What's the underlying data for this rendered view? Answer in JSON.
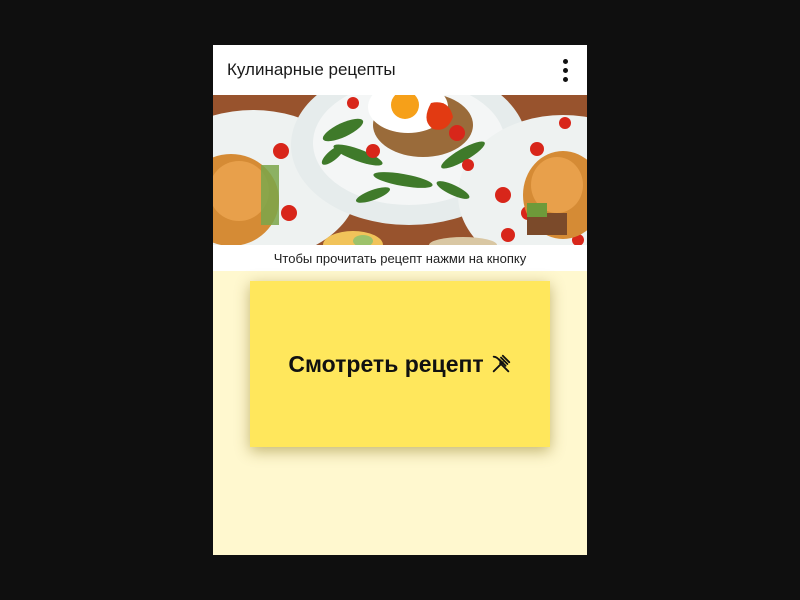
{
  "appbar": {
    "title": "Кулинарные рецепты",
    "menu_icon": "more-vert-icon"
  },
  "hero": {
    "image_icon": "food-photo"
  },
  "caption": {
    "text": "Чтобы прочитать рецепт нажми на кнопку"
  },
  "cta": {
    "label": "Смотреть рецепт",
    "icon": "utensils-icon",
    "color": "#ffe75c"
  },
  "colors": {
    "background": "#0f0f0f",
    "screen": "#fff8cf",
    "bar": "#ffffff"
  }
}
